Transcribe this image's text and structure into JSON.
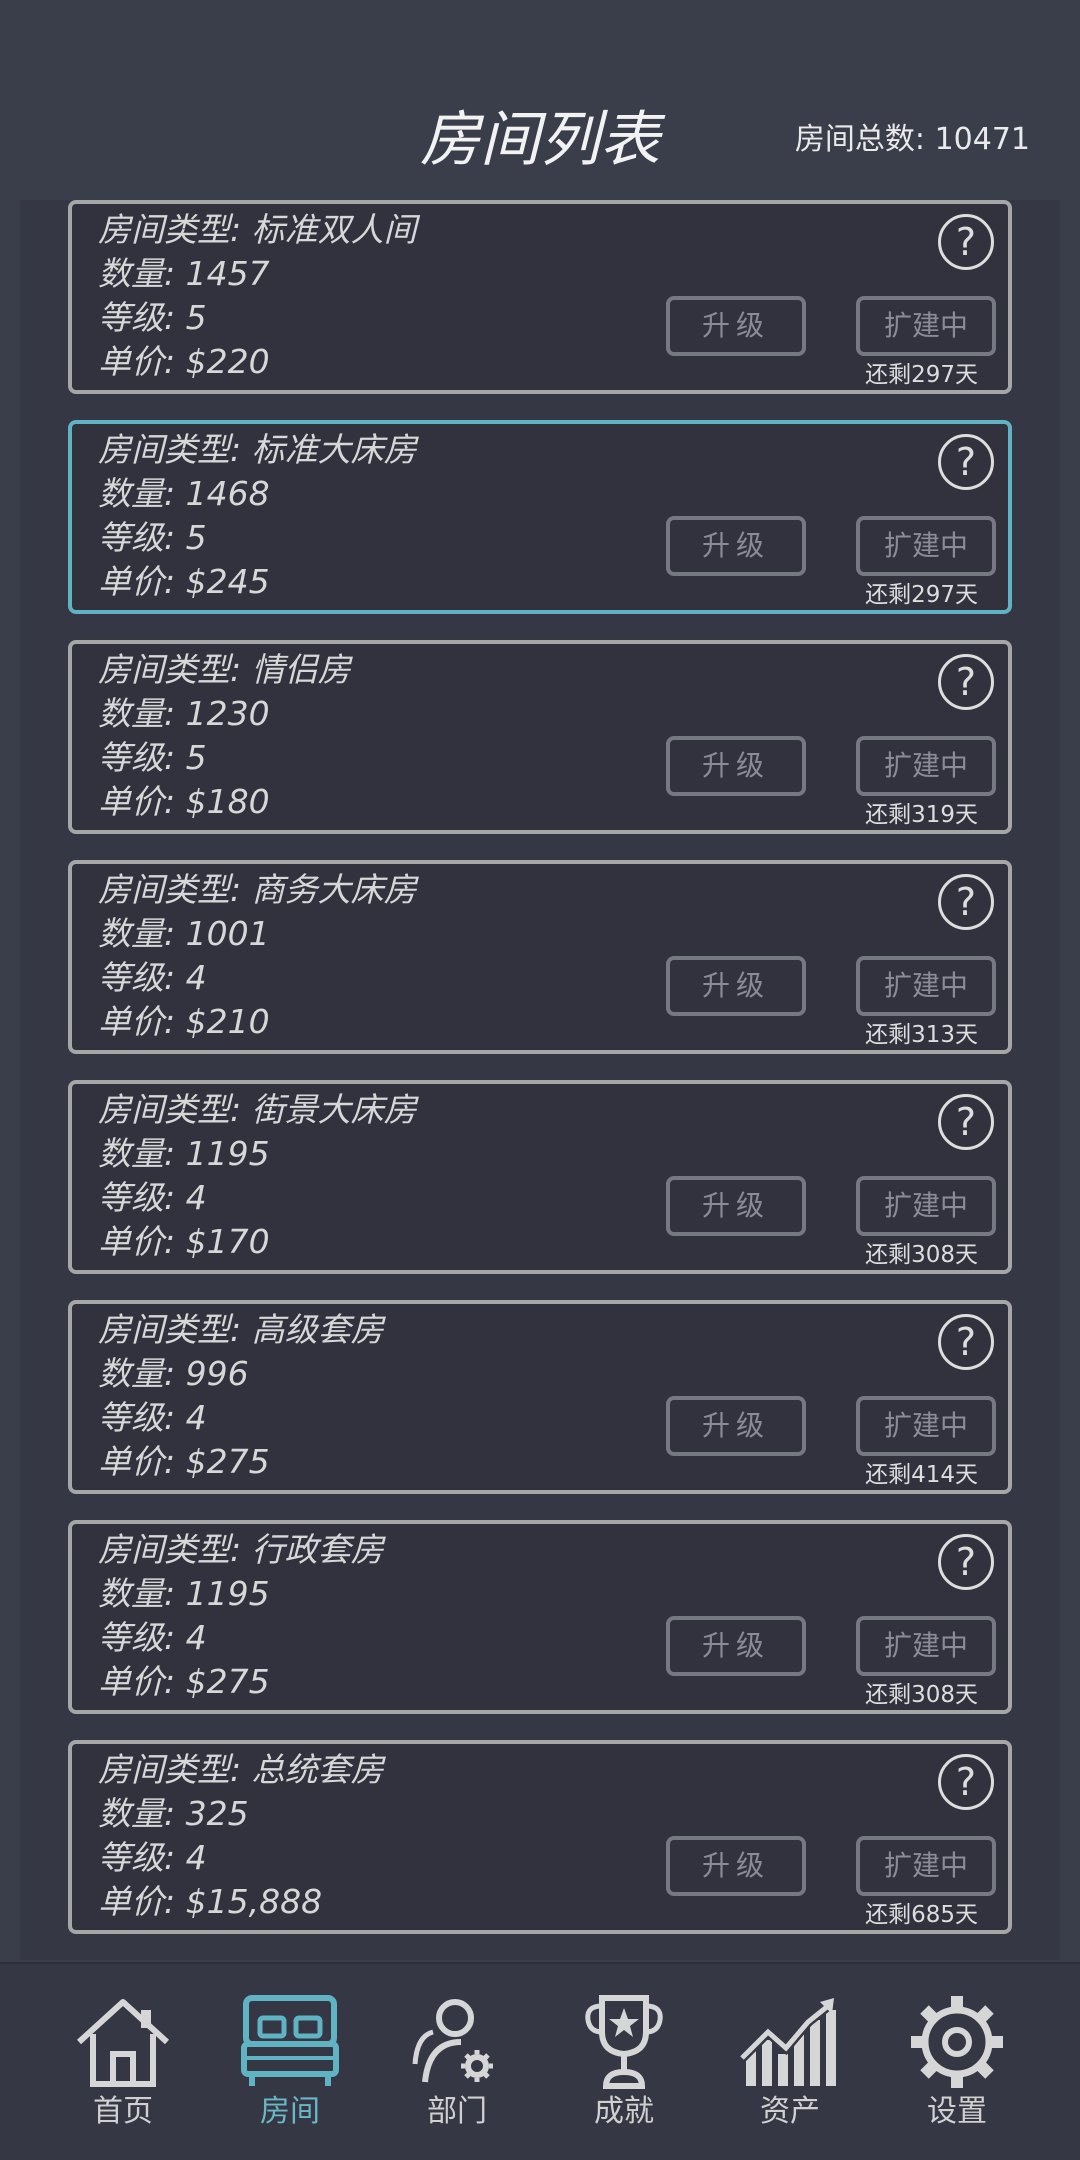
{
  "header": {
    "title": "房间列表",
    "room_total": "房间总数: 10471"
  },
  "room_cards": [
    {
      "type": "房间类型: 标准双人间",
      "count": "数量: 1457",
      "level": "等级: 5",
      "price": "单价: $220",
      "upgrade_label": "升级",
      "expand_label": "扩建中",
      "remaining": "还剩297天",
      "selected": false
    },
    {
      "type": "房间类型: 标准大床房",
      "count": "数量: 1468",
      "level": "等级: 5",
      "price": "单价: $245",
      "upgrade_label": "升级",
      "expand_label": "扩建中",
      "remaining": "还剩297天",
      "selected": true
    },
    {
      "type": "房间类型: 情侣房",
      "count": "数量: 1230",
      "level": "等级: 5",
      "price": "单价: $180",
      "upgrade_label": "升级",
      "expand_label": "扩建中",
      "remaining": "还剩319天",
      "selected": false
    },
    {
      "type": "房间类型: 商务大床房",
      "count": "数量: 1001",
      "level": "等级: 4",
      "price": "单价: $210",
      "upgrade_label": "升级",
      "expand_label": "扩建中",
      "remaining": "还剩313天",
      "selected": false
    },
    {
      "type": "房间类型: 街景大床房",
      "count": "数量: 1195",
      "level": "等级: 4",
      "price": "单价: $170",
      "upgrade_label": "升级",
      "expand_label": "扩建中",
      "remaining": "还剩308天",
      "selected": false
    },
    {
      "type": "房间类型: 高级套房",
      "count": "数量: 996",
      "level": "等级: 4",
      "price": "单价: $275",
      "upgrade_label": "升级",
      "expand_label": "扩建中",
      "remaining": "还剩414天",
      "selected": false
    },
    {
      "type": "房间类型: 行政套房",
      "count": "数量: 1195",
      "level": "等级: 4",
      "price": "单价: $275",
      "upgrade_label": "升级",
      "expand_label": "扩建中",
      "remaining": "还剩308天",
      "selected": false
    },
    {
      "type": "房间类型: 总统套房",
      "count": "数量: 325",
      "level": "等级: 4",
      "price": "单价: $15,888",
      "upgrade_label": "升级",
      "expand_label": "扩建中",
      "remaining": "还剩685天",
      "selected": false
    }
  ],
  "help_icon": "question-circle-icon",
  "nav": {
    "items": [
      {
        "label": "首页",
        "icon": "home-icon",
        "active": false
      },
      {
        "label": "房间",
        "icon": "bed-icon",
        "active": true
      },
      {
        "label": "部门",
        "icon": "department-icon",
        "active": false
      },
      {
        "label": "成就",
        "icon": "trophy-icon",
        "active": false
      },
      {
        "label": "资产",
        "icon": "assets-chart-icon",
        "active": false
      },
      {
        "label": "设置",
        "icon": "gear-icon",
        "active": false
      }
    ]
  },
  "colors": {
    "background": "#3a3d4a",
    "card_border": "#a6a6a6",
    "selected_border": "#5fb3c3",
    "active_nav": "#6ab8c6"
  }
}
